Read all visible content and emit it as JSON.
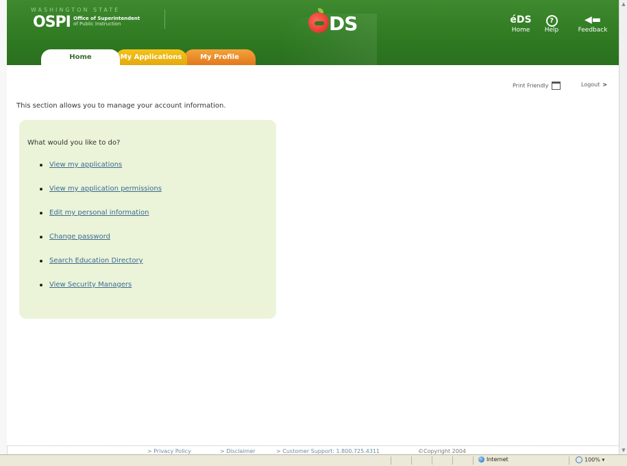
{
  "header": {
    "ospi_state": "WASHINGTON STATE",
    "ospi_mark": "OSPI",
    "ospi_office": "Office of Superintendent",
    "ospi_public": "of Public Instruction",
    "app_logo": "DS",
    "nav": [
      {
        "label": "Home",
        "icon": "eds-home-icon"
      },
      {
        "label": "Help",
        "icon": "help-icon"
      },
      {
        "label": "Feedback",
        "icon": "megaphone-icon"
      }
    ]
  },
  "tabs": [
    {
      "label": "Home",
      "active": true
    },
    {
      "label": "My Applications",
      "active": false
    },
    {
      "label": "My Profile",
      "active": false
    }
  ],
  "utility": {
    "print_label": "Print Friendly",
    "logout_label": "Logout"
  },
  "main": {
    "intro": "This section allows you to manage your account information.",
    "panel_title": "What would you like to do?",
    "links": [
      "View my applications",
      "View my application permissions",
      "Edit my personal information",
      "Change password",
      "Search Education Directory",
      "View Security Managers"
    ]
  },
  "footer": {
    "privacy": "> Privacy Policy",
    "disclaimer": "> Disclaimer",
    "support": "> Customer Support: 1.800.725.4311",
    "copyright": "©Copyright 2004"
  },
  "statusbar": {
    "zone": "Internet",
    "zoom": "100%"
  },
  "colors": {
    "header_green": "#2f7a22",
    "tab_apps": "#e4a90f",
    "tab_profile": "#e2791d",
    "panel_bg": "#ebf3d9",
    "link": "#3b6b8f"
  }
}
